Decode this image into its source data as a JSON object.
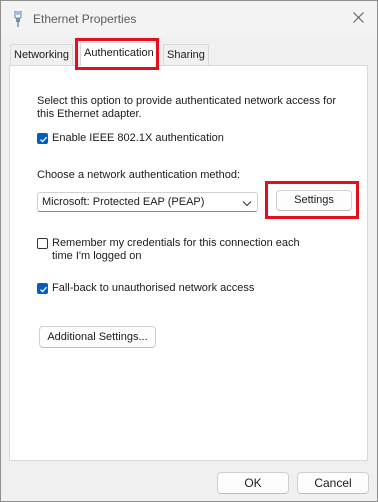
{
  "window": {
    "title": "Ethernet Properties",
    "icon": "ethernet-plug-icon",
    "close_icon": "close-icon"
  },
  "tabs": [
    {
      "label": "Networking",
      "active": false
    },
    {
      "label": "Authentication",
      "active": true
    },
    {
      "label": "Sharing",
      "active": false
    }
  ],
  "panel": {
    "description": "Select this option to provide authenticated network access for this Ethernet adapter.",
    "enable_8021x": {
      "label": "Enable IEEE 802.1X authentication",
      "checked": true
    },
    "method_label": "Choose a network authentication method:",
    "method_select": {
      "value": "Microsoft: Protected EAP (PEAP)",
      "icon": "chevron-down-icon"
    },
    "settings_button": "Settings",
    "remember_credentials": {
      "label": "Remember my credentials for this connection each time I'm logged on",
      "checked": false
    },
    "fallback": {
      "label": "Fall-back to unauthorised network access",
      "checked": true
    },
    "additional_settings_button": "Additional Settings..."
  },
  "footer": {
    "ok_button": "OK",
    "cancel_button": "Cancel"
  },
  "highlights": {
    "color": "#e2101c",
    "targets": [
      "tab-authentication",
      "settings-button"
    ]
  },
  "colors": {
    "accent": "#005fb8",
    "highlight": "#e2101c"
  }
}
